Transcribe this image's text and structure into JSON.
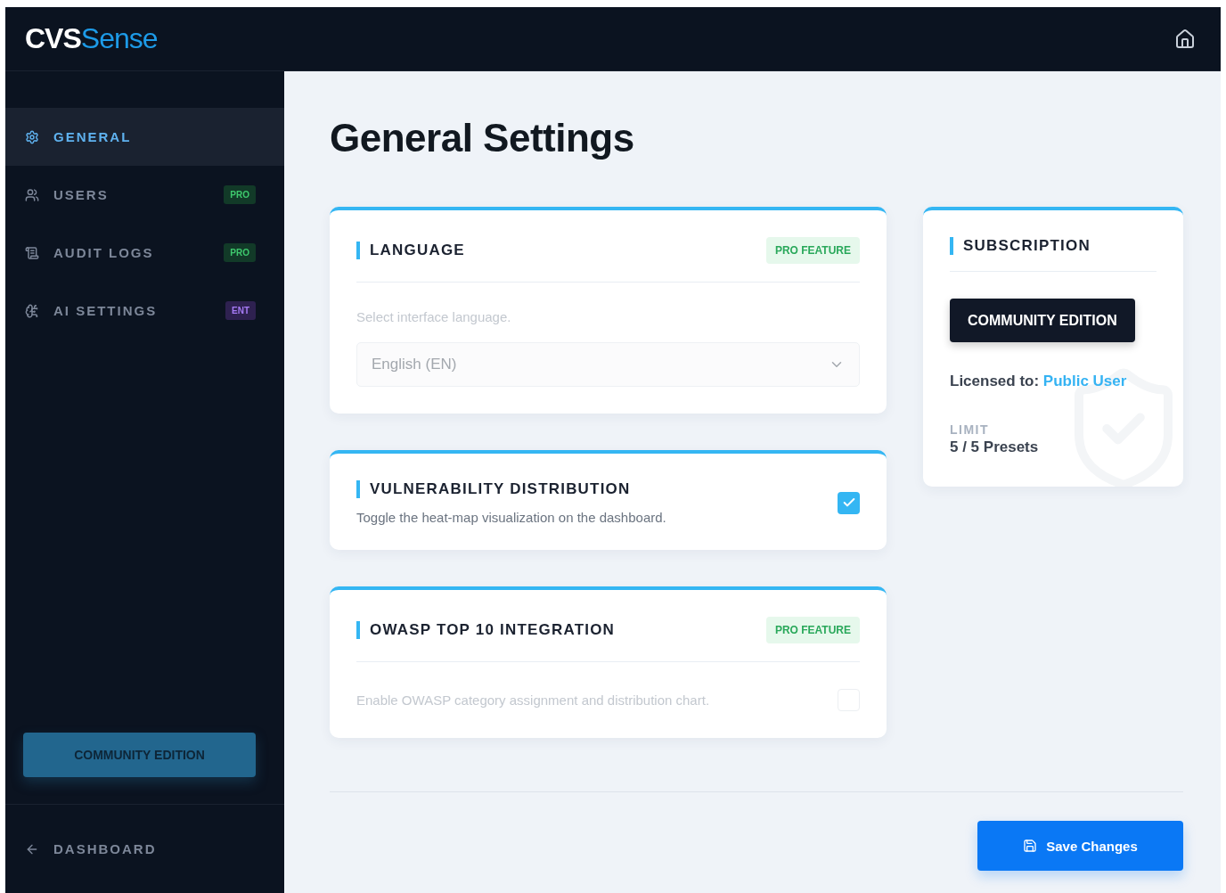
{
  "header": {
    "logo_primary": "CVS",
    "logo_accent": "Sense"
  },
  "sidebar": {
    "items": [
      {
        "label": "GENERAL",
        "selected": true
      },
      {
        "label": "USERS",
        "selected": false,
        "badge": {
          "text": "PRO",
          "kind": "pro"
        }
      },
      {
        "label": "AUDIT LOGS",
        "selected": false,
        "badge": {
          "text": "PRO",
          "kind": "pro"
        }
      },
      {
        "label": "AI SETTINGS",
        "selected": false,
        "badge": {
          "text": "ENT",
          "kind": "ent"
        }
      }
    ],
    "edition_button": "COMMUNITY EDITION",
    "back_link": "DASHBOARD"
  },
  "page_title": "General Settings",
  "settings": [
    {
      "kind": "select",
      "title": "LANGUAGE",
      "badge": "PRO FEATURE",
      "description": "Select interface language.",
      "value": "English (EN)",
      "disabled": true
    },
    {
      "kind": "toggle",
      "title": "VULNERABILITY DISTRIBUTION",
      "description": "Toggle the heat-map visualization on the dashboard.",
      "checked": true,
      "disabled": false
    },
    {
      "kind": "toggle",
      "title": "OWASP TOP 10 INTEGRATION",
      "badge": "PRO FEATURE",
      "description": "Enable OWASP category assignment and distribution chart.",
      "checked": false,
      "disabled": true
    }
  ],
  "subscription": {
    "title": "SUBSCRIPTION",
    "edition": "COMMUNITY EDITION",
    "licensed_label": "Licensed to:",
    "licensed_to": "Public User",
    "limit_label": "LIMIT",
    "limit_value": "5 / 5 Presets"
  },
  "save_button": "Save Changes"
}
